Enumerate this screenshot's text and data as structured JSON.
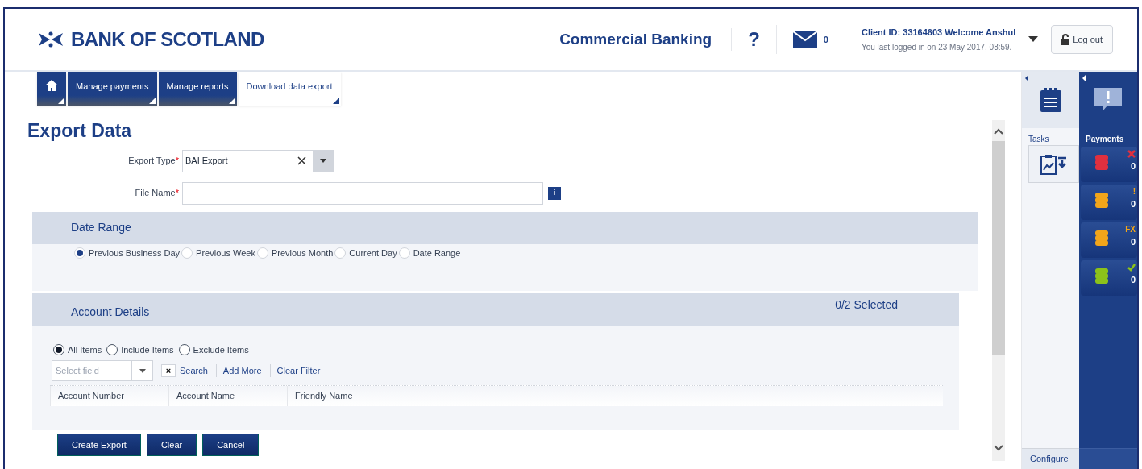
{
  "header": {
    "brand": "BANK OF SCOTLAND",
    "product": "Commercial Banking",
    "help": "?",
    "messages": "0",
    "client": "Client ID: 33164603 Welcome Anshul",
    "last_login": "You last logged in on 23 May 2017, 08:59.",
    "logout": "Log out"
  },
  "nav": [
    {
      "kind": "home",
      "selected": false
    },
    {
      "kind": "text",
      "label": "Manage payments",
      "selected": false
    },
    {
      "kind": "text",
      "label": "Manage reports",
      "selected": false
    },
    {
      "kind": "text",
      "label": "Download data export",
      "selected": true
    }
  ],
  "title": "Export Data",
  "form": {
    "export_type": {
      "label": "Export Type",
      "required": "*",
      "value": "BAI Export"
    },
    "file_name": {
      "label": "File Name",
      "required": "*",
      "info": "i"
    }
  },
  "date_range": {
    "title": "Date Range",
    "options": [
      {
        "label": "Previous Business Day",
        "selected": true
      },
      {
        "label": "Previous Week",
        "selected": false
      },
      {
        "label": "Previous Month",
        "selected": false
      },
      {
        "label": "Current Day",
        "selected": false
      },
      {
        "label": "Date Range",
        "selected": false
      }
    ]
  },
  "account_details": {
    "title": "Account Details",
    "count": "0/2 Selected",
    "scope": [
      {
        "label": "All Items",
        "selected": true
      },
      {
        "label": "Include Items",
        "selected": false
      },
      {
        "label": "Exclude Items",
        "selected": false
      }
    ],
    "filter": {
      "placeholder": "Select field",
      "clear": "×",
      "links": [
        "Search",
        "Add More",
        "Clear Filter"
      ]
    },
    "columns": [
      "Account Number",
      "Account Name",
      "Friendly Name"
    ]
  },
  "buttons": [
    "Create Export",
    "Clear",
    "Cancel"
  ],
  "tasks": {
    "title": "Tasks",
    "configure": "Configure"
  },
  "payments": {
    "title": "Payments",
    "items": [
      {
        "kind": "cross",
        "color": "#e0303f",
        "count": "0"
      },
      {
        "kind": "text",
        "badge": "!",
        "color": "#f2a51a",
        "count": "0"
      },
      {
        "kind": "text",
        "badge": "FX",
        "color": "#f2a51a",
        "count": "0"
      },
      {
        "kind": "tick",
        "color": "#8cc21a",
        "count": "0"
      }
    ]
  }
}
